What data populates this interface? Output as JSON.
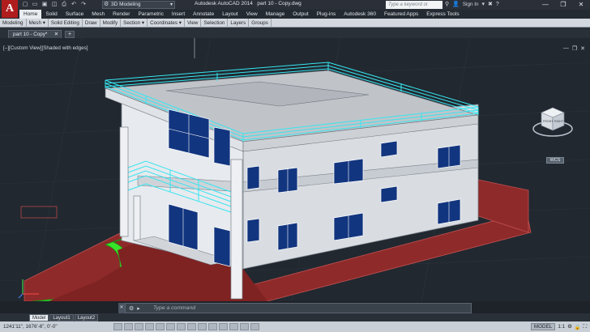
{
  "app": {
    "logo_letter": "A",
    "title": "Autodesk AutoCAD 2014",
    "document": "part 10 - Copy.dwg",
    "workspace": "3D Modeling",
    "search_placeholder": "Type a keyword or phrase",
    "sign_in": "Sign In",
    "window_controls": [
      "—",
      "❐",
      "✕"
    ]
  },
  "ribbon": {
    "tabs": [
      "Home",
      "Solid",
      "Surface",
      "Mesh",
      "Render",
      "Parametric",
      "Insert",
      "Annotate",
      "Layout",
      "View",
      "Manage",
      "Output",
      "Plug-ins",
      "Autodesk 360",
      "Featured Apps",
      "Express Tools"
    ],
    "active_tab": "Home",
    "panels": [
      "Modeling",
      "Mesh ▾",
      "Solid Editing",
      "Draw",
      "Modify",
      "Section ▾",
      "Coordinates ▾",
      "View",
      "Selection",
      "Layers",
      "Groups"
    ]
  },
  "file_tab": {
    "label": "part 10 - Copy*",
    "close": "✕",
    "new": "+"
  },
  "viewport": {
    "label": "[–][Custom View][Shaded with edges]",
    "controls": [
      "—",
      "❐",
      "✕"
    ],
    "viewcube": {
      "front": "FRONT",
      "right": "RIGHT"
    },
    "wcs": "WCS"
  },
  "command_line": {
    "prompt": "Type a command",
    "buttons": [
      "✕",
      "🔧",
      "▸_"
    ]
  },
  "layout_tabs": [
    "Model",
    "Layout1",
    "Layout2"
  ],
  "active_layout": "Model",
  "status": {
    "coords": "1241'11\", 1676'-6\", 0'-0\"",
    "model": "MODEL",
    "scale": "1:1"
  },
  "colors": {
    "accent_cyan": "#36e6f0",
    "lawn_green": "#37e329",
    "ground_red": "#8f2a2a",
    "ribbon_bg": "#242a31",
    "viewport_bg": "#212830"
  }
}
